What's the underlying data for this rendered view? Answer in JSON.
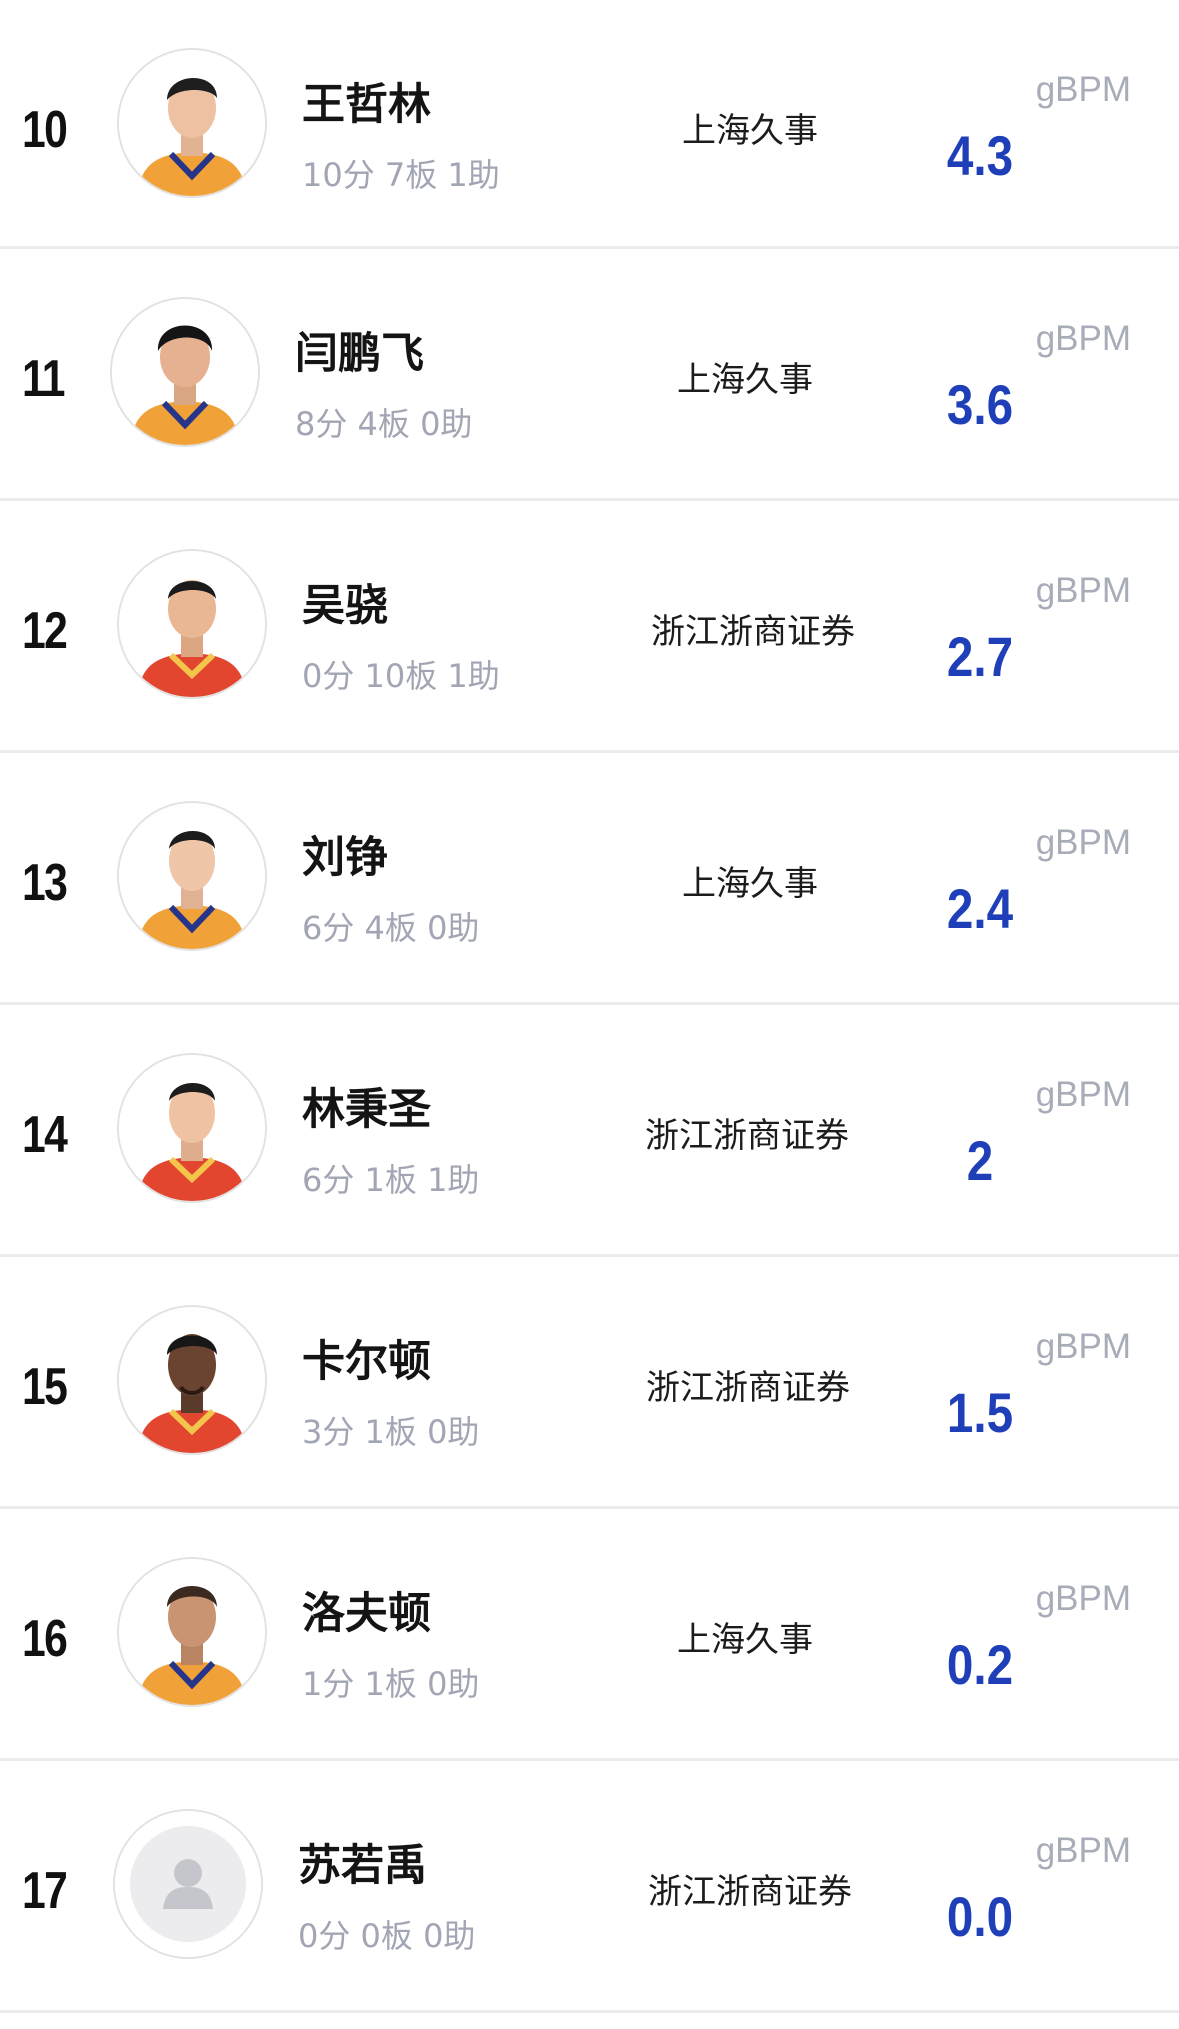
{
  "colors": {
    "accent_value": "#1f3fb8",
    "secondary_text": "#a2a6b4",
    "divider": "#ebebeb",
    "jersey_orange": "#f0a137",
    "jersey_red": "#e3462f"
  },
  "players": [
    {
      "rank": "10",
      "name": "王哲林",
      "stats": "10分 7板 1助",
      "team": "上海久事",
      "metric_label": "gBPM",
      "metric_value": "4.3",
      "avatar": "player-photo-orange-jersey"
    },
    {
      "rank": "11",
      "name": "闫鹏飞",
      "stats": "8分 4板 0助",
      "team": "上海久事",
      "metric_label": "gBPM",
      "metric_value": "3.6",
      "avatar": "player-photo-orange-jersey"
    },
    {
      "rank": "12",
      "name": "吴骁",
      "stats": "0分 10板 1助",
      "team": "浙江浙商证券",
      "metric_label": "gBPM",
      "metric_value": "2.7",
      "avatar": "player-photo-red-jersey"
    },
    {
      "rank": "13",
      "name": "刘铮",
      "stats": "6分 4板 0助",
      "team": "上海久事",
      "metric_label": "gBPM",
      "metric_value": "2.4",
      "avatar": "player-photo-orange-jersey"
    },
    {
      "rank": "14",
      "name": "林秉圣",
      "stats": "6分 1板 1助",
      "team": "浙江浙商证券",
      "metric_label": "gBPM",
      "metric_value": "2",
      "avatar": "player-photo-red-jersey"
    },
    {
      "rank": "15",
      "name": "卡尔顿",
      "stats": "3分 1板 0助",
      "team": "浙江浙商证券",
      "metric_label": "gBPM",
      "metric_value": "1.5",
      "avatar": "player-photo-red-jersey"
    },
    {
      "rank": "16",
      "name": "洛夫顿",
      "stats": "1分 1板 0助",
      "team": "上海久事",
      "metric_label": "gBPM",
      "metric_value": "0.2",
      "avatar": "player-photo-orange-jersey"
    },
    {
      "rank": "17",
      "name": "苏若禹",
      "stats": "0分 0板 0助",
      "team": "浙江浙商证券",
      "metric_label": "gBPM",
      "metric_value": "0.0",
      "avatar": "default-avatar-icon"
    }
  ]
}
